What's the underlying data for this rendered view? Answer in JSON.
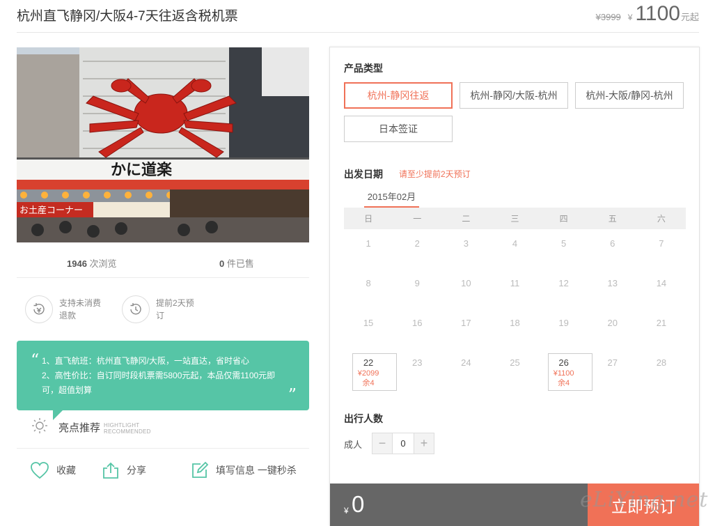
{
  "header": {
    "title": "杭州直飞静冈/大阪4-7天往返含税机票",
    "original_price": "¥3999",
    "currency": "¥",
    "price": "1100",
    "price_suffix": "元起"
  },
  "stats": {
    "views_count": "1946",
    "views_label": "次浏览",
    "sold_count": "0",
    "sold_label": "件已售"
  },
  "features": [
    {
      "icon": "refund-icon",
      "text": "支持未消费退款"
    },
    {
      "icon": "clock-icon",
      "text": "提前2天预订"
    }
  ],
  "highlights": {
    "line1": "1、直飞航班：杭州直飞静冈/大阪，一站直达，省时省心",
    "line2": "2、高性价比：自订同时段机票需5800元起，本品仅需1100元即可，超值划算",
    "title": "亮点推荐",
    "title_en_1": "HIGHTLIGHT",
    "title_en_2": "RECOMMENDED"
  },
  "actions": {
    "favorite": "收藏",
    "share": "分享",
    "fill_info": "填写信息 一键秒杀"
  },
  "booking": {
    "product_type_label": "产品类型",
    "product_types": [
      {
        "label": "杭州-静冈往返",
        "active": true
      },
      {
        "label": "杭州-静冈/大阪-杭州",
        "active": false
      },
      {
        "label": "杭州-大阪/静冈-杭州",
        "active": false
      },
      {
        "label": "日本签证",
        "active": false
      }
    ],
    "date_label": "出发日期",
    "date_hint": "请至少提前2天预订",
    "month": "2015年02月",
    "weekdays": [
      "日",
      "一",
      "二",
      "三",
      "四",
      "五",
      "六"
    ],
    "days": [
      {
        "d": "1"
      },
      {
        "d": "2"
      },
      {
        "d": "3"
      },
      {
        "d": "4"
      },
      {
        "d": "5"
      },
      {
        "d": "6"
      },
      {
        "d": "7"
      },
      {
        "d": "8"
      },
      {
        "d": "9"
      },
      {
        "d": "10"
      },
      {
        "d": "11"
      },
      {
        "d": "12"
      },
      {
        "d": "13"
      },
      {
        "d": "14"
      },
      {
        "d": "15"
      },
      {
        "d": "16"
      },
      {
        "d": "17"
      },
      {
        "d": "18"
      },
      {
        "d": "19"
      },
      {
        "d": "20"
      },
      {
        "d": "21"
      },
      {
        "d": "22",
        "price": "¥2099",
        "left": "余4"
      },
      {
        "d": "23"
      },
      {
        "d": "24"
      },
      {
        "d": "25"
      },
      {
        "d": "26",
        "price": "¥1100",
        "left": "余4"
      },
      {
        "d": "27"
      },
      {
        "d": "28"
      }
    ],
    "travelers_label": "出行人数",
    "adult_label": "成人",
    "adult_count": "0",
    "minus": "−",
    "plus": "+",
    "total_currency": "¥",
    "total": "0",
    "book_button": "立即预订"
  },
  "watermark": "eLiYing.net",
  "colors": {
    "accent": "#f07157",
    "highlight_bg": "#56c5a6",
    "total_bar": "#666666"
  }
}
